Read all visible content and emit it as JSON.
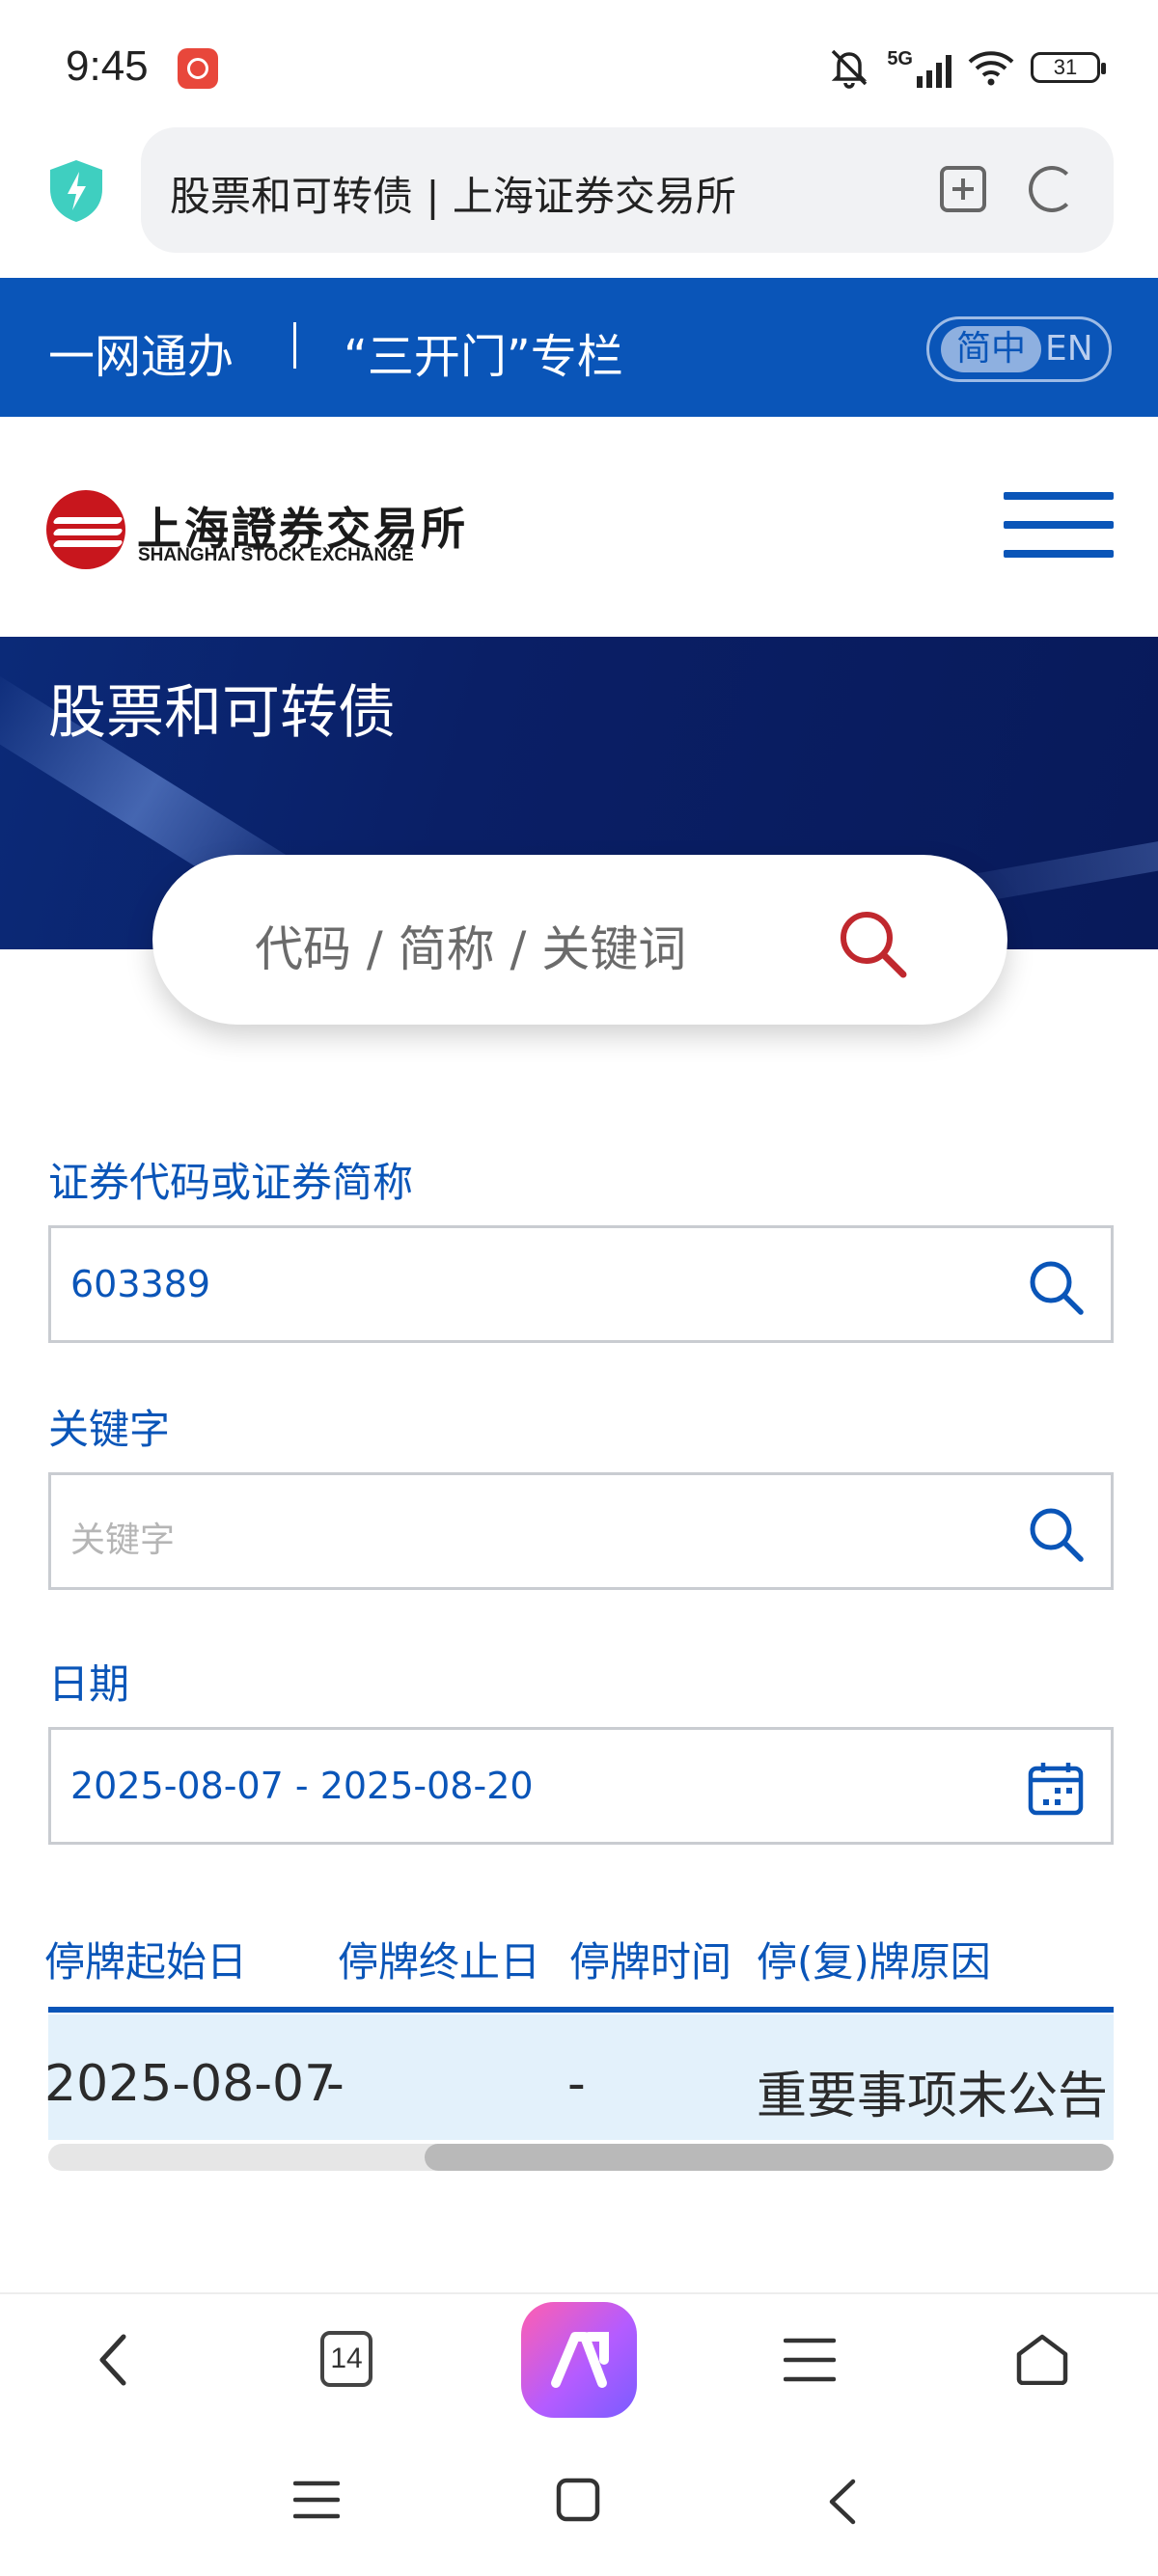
{
  "status_bar": {
    "time": "9:45",
    "network": "5G",
    "battery": "31",
    "icons": [
      "app-notification-icon",
      "mute-bell-icon",
      "signal-icon",
      "wifi-icon",
      "battery-icon"
    ]
  },
  "browser": {
    "url_title": "股票和可转债 | 上海证券交易所",
    "tab_count": "14",
    "icons": [
      "shield-icon",
      "add-bookmark-icon",
      "reload-icon",
      "back-icon",
      "tabs-icon",
      "ai-assistant-icon",
      "menu-icon",
      "home-icon"
    ]
  },
  "top_bar": {
    "link_1": "一网通办",
    "link_2": "“三开门”专栏",
    "lang_zh": "简中",
    "lang_en": "EN"
  },
  "logo": {
    "name_cn": "上海證券交易所",
    "name_en": "SHANGHAI STOCK EXCHANGE"
  },
  "hero": {
    "title": "股票和可转债",
    "search_placeholder": "代码 / 简称 / 关键词"
  },
  "filters": {
    "code_label": "证券代码或证券简称",
    "code_value": "603389",
    "keyword_label": "关键字",
    "keyword_placeholder": "关键字",
    "date_label": "日期",
    "date_value": "2025-08-07 - 2025-08-20"
  },
  "table": {
    "headers": [
      "停牌起始日",
      "停牌终止日",
      "停牌时间",
      "停(复)牌原因"
    ],
    "rows": [
      [
        "2025-08-07",
        "-",
        "-",
        "重要事项未公告"
      ]
    ],
    "scroll_position": 0.35
  },
  "colors": {
    "brand_blue": "#0a55b8",
    "hero_navy": "#0a1f66",
    "logo_red": "#c8161d",
    "row_highlight": "#e3f1fb"
  }
}
